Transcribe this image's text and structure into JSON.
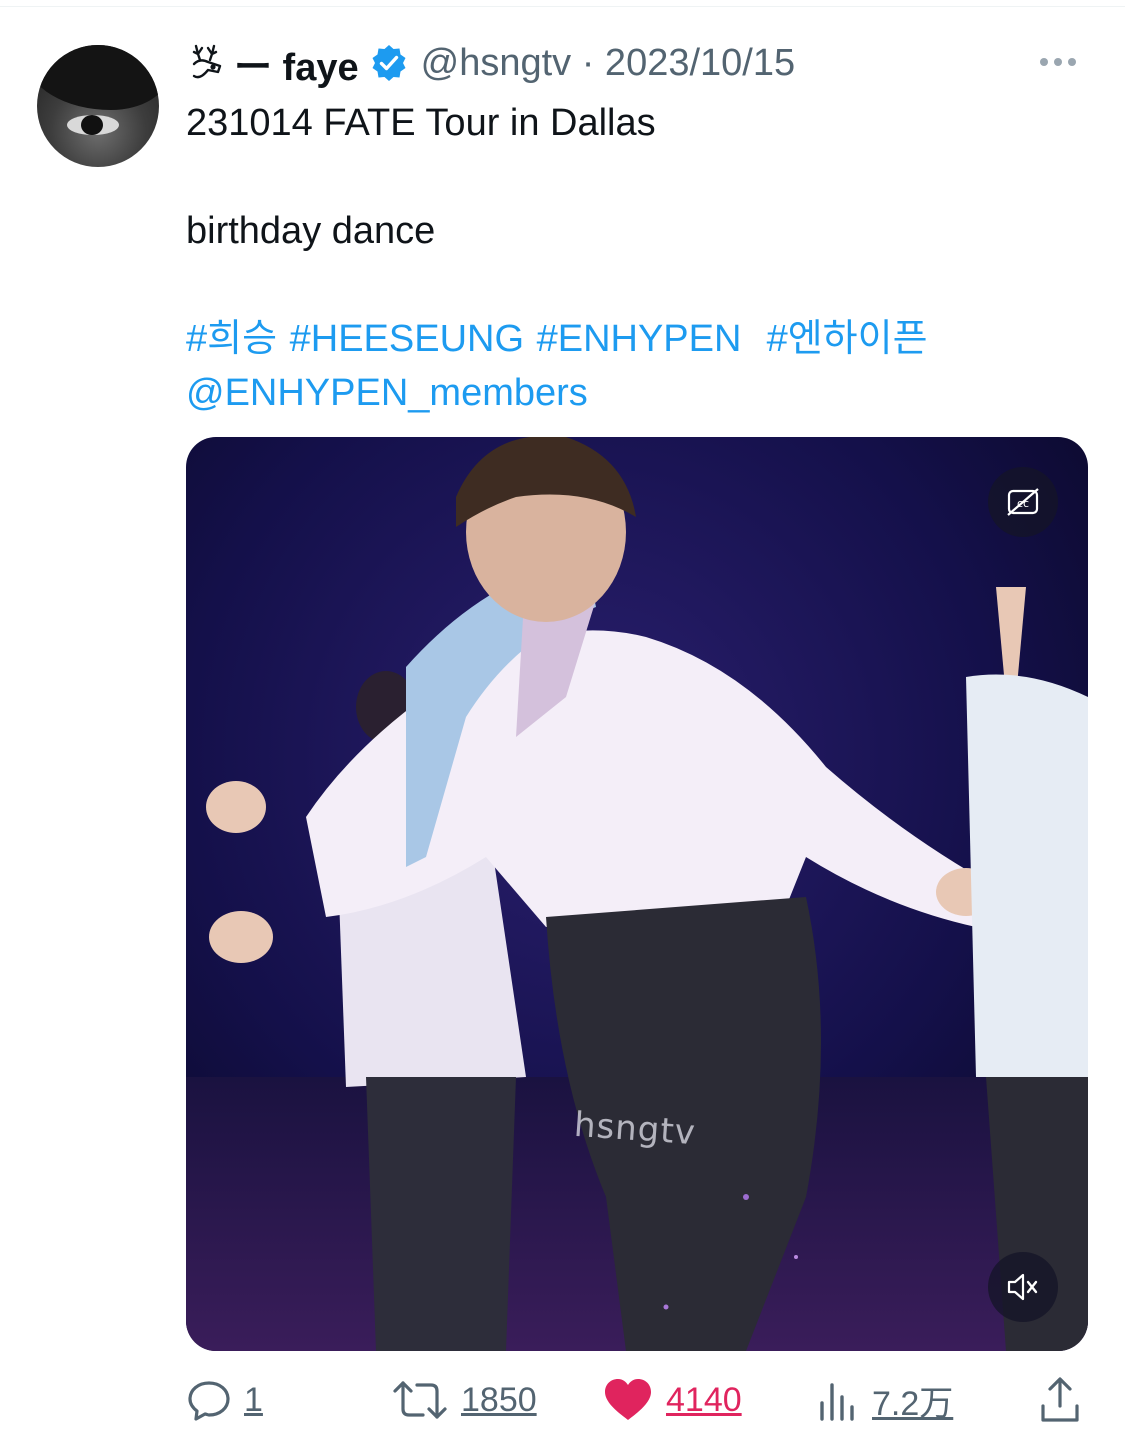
{
  "author": {
    "display_name": "ー faye",
    "handle_date": "@hsngtv · 2023/10/15"
  },
  "tweet": {
    "line1": "231014 FATE Tour in Dallas",
    "line2": "birthday dance",
    "hashtags": [
      "#희승",
      "#HEESEUNG",
      "#ENHYPEN",
      "#엔하이픈"
    ],
    "mention": "@ENHYPEN_members"
  },
  "media": {
    "watermark": "hsngtv"
  },
  "actions": {
    "replies": "1",
    "retweets": "1850",
    "likes": "4140",
    "views": "7.2万"
  },
  "colors": {
    "link": "#1d9bf0",
    "like": "#e0245e",
    "muted": "#536471",
    "verified": "#1d9bf0"
  },
  "icons": [
    "deer-icon",
    "verified-icon",
    "more-icon",
    "closed-captions-icon",
    "mute-icon",
    "reply-icon",
    "retweet-icon",
    "like-icon",
    "views-icon",
    "share-icon"
  ]
}
